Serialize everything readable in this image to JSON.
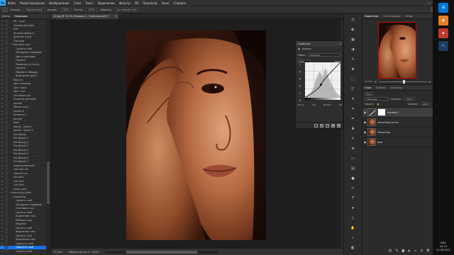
{
  "app": {
    "logo": "Ps",
    "menu": [
      "Файл",
      "Редактирование",
      "Изображение",
      "Слои",
      "Текст",
      "Выделение",
      "Фильтр",
      "3D",
      "Просмотр",
      "Окно",
      "Справка"
    ],
    "window_controls": [
      "—",
      "❐",
      "✕"
    ]
  },
  "options": {
    "fields": [
      {
        "label": "Размер:",
        "value": "Нормальный"
      },
      {
        "label": "Нажим:",
        "value": "100%"
      },
      {
        "label": "Поток:",
        "value": "100%"
      },
      {
        "label": "Образец:",
        "value": "Активный слой"
      }
    ],
    "icons": [
      "search-icon",
      "workspace-icon",
      "share-icon"
    ]
  },
  "left_panel": {
    "tabs": [
      "Кисти",
      "Операции"
    ],
    "active_tab": "Операции",
    "actions": [
      {
        "label": "RB - Layer",
        "indent": 1,
        "caret": false
      },
      {
        "label": "Гринфи для fixed",
        "indent": 1,
        "caret": false
      },
      {
        "label": "Dub",
        "indent": 1,
        "caret": false
      },
      {
        "label": "Интерактивность",
        "indent": 1,
        "caret": false
      },
      {
        "label": "Дожатие и осв",
        "indent": 1,
        "caret": false
      },
      {
        "label": "Текстура",
        "indent": 1,
        "caret": false
      },
      {
        "label": "Контроль пор",
        "indent": 1,
        "caret": true
      },
      {
        "label": "Сделать слой",
        "indent": 2,
        "caret": false
      },
      {
        "label": "Объединить видимые",
        "indent": 2,
        "caret": false
      },
      {
        "label": "Цвет в цветовые",
        "indent": 2,
        "caret": false
      },
      {
        "label": "Сделать",
        "indent": 2,
        "caret": false
      },
      {
        "label": "Размытие по Гауссу",
        "indent": 2,
        "caret": false
      },
      {
        "label": "Сделать",
        "indent": 2,
        "caret": false
      },
      {
        "label": "Обратить Обводку",
        "indent": 2,
        "caret": false
      },
      {
        "label": "Выделение цвета",
        "indent": 2,
        "caret": false
      },
      {
        "label": "Яркость",
        "indent": 1,
        "caret": false
      },
      {
        "label": "Цвет площади",
        "indent": 1,
        "caret": false
      },
      {
        "label": "Цвет кожи",
        "indent": 1,
        "caret": false
      },
      {
        "label": "Цвет глаз",
        "indent": 1,
        "caret": false
      },
      {
        "label": "Gilla Boxes сол",
        "indent": 1,
        "caret": false
      },
      {
        "label": "Усиление деталей",
        "indent": 1,
        "caret": false
      },
      {
        "label": "резкий",
        "indent": 1,
        "caret": false
      },
      {
        "label": "Общая кожа",
        "indent": 1,
        "caret": false
      },
      {
        "label": "резкость",
        "indent": 1,
        "caret": false
      },
      {
        "label": "резкость 2",
        "indent": 1,
        "caret": false
      },
      {
        "label": "резкий",
        "indent": 1,
        "caret": false
      },
      {
        "label": "Цвет",
        "indent": 1,
        "caret": false
      },
      {
        "label": "beauty - Бьюти",
        "indent": 1,
        "caret": false
      },
      {
        "label": "beauty - Бьюти 2",
        "indent": 1,
        "caret": false
      },
      {
        "label": "fine Beauty",
        "indent": 1,
        "caret": false
      },
      {
        "label": "fine Beauty 1",
        "indent": 1,
        "caret": false
      },
      {
        "label": "fine Beauty 2",
        "indent": 1,
        "caret": false
      },
      {
        "label": "fine Beauty 3",
        "indent": 1,
        "caret": false
      },
      {
        "label": "fine Beauty 4",
        "indent": 1,
        "caret": false
      },
      {
        "label": "fine Beauty 5",
        "indent": 1,
        "caret": false
      },
      {
        "label": "fine Beauty 6",
        "indent": 1,
        "caret": false
      },
      {
        "label": "fine Beauty 7",
        "indent": 1,
        "caret": false
      },
      {
        "label": "художественный",
        "indent": 1,
        "caret": false
      },
      {
        "label": "светлый тон",
        "indent": 1,
        "caret": false
      },
      {
        "label": "тёмный тон",
        "indent": 1,
        "caret": false
      },
      {
        "label": "lab mest",
        "indent": 1,
        "caret": false
      },
      {
        "label": "Lab Chell",
        "indent": 1,
        "caret": false
      },
      {
        "label": "Lab Chell",
        "indent": 1,
        "caret": false
      },
      {
        "label": "новое дает",
        "indent": 1,
        "caret": false
      },
      {
        "label": "retouching_prime",
        "indent": 0,
        "caret": true
      },
      {
        "label": "retouching",
        "indent": 1,
        "caret": true
      },
      {
        "label": "Сделать слой",
        "indent": 2,
        "caret": false
      },
      {
        "label": "Объединить видимые",
        "indent": 2,
        "caret": false
      },
      {
        "label": "Установить как",
        "indent": 2,
        "caret": false
      },
      {
        "label": "Сделать слой",
        "indent": 2,
        "caret": false
      },
      {
        "label": "Выделение слоя",
        "indent": 2,
        "caret": false
      },
      {
        "label": "Обводка слоя",
        "indent": 2,
        "caret": false
      },
      {
        "label": "Медиана",
        "indent": 2,
        "caret": false
      },
      {
        "label": "Сделать слой",
        "indent": 2,
        "caret": false
      },
      {
        "label": "Выделение слоя",
        "indent": 2,
        "caret": false
      },
      {
        "label": "Сделать слой",
        "indent": 2,
        "caret": false
      },
      {
        "label": "Выделение слоя",
        "indent": 2,
        "caret": false
      },
      {
        "label": "Сдвинуть слой",
        "indent": 2,
        "caret": false
      },
      {
        "label": "Сдвинуть слой",
        "indent": 2,
        "caret": false
      },
      {
        "label": "Сделать слой",
        "indent": 2,
        "caret": false
      }
    ],
    "selected_index": 58
  },
  "document": {
    "tab_title": "20.jpg @ 33,3% (Кривые 1, Слой-маска/8) *",
    "tab_close": "✕",
    "zoom": "33,33%",
    "status": "Эффективность: 100%*"
  },
  "properties": {
    "title": "Свойства",
    "close": "✕",
    "type_label": "Кривые",
    "preset_label": "Набор:",
    "preset_value": "Заказная",
    "channel_value": "RGB",
    "auto_label": "Авто",
    "input_label": "Вход:",
    "input_value": "114",
    "output_label": "Выход:",
    "output_value": "94",
    "curve_points": [
      [
        0,
        0
      ],
      [
        114,
        94
      ],
      [
        255,
        255
      ]
    ],
    "histogram": [
      2,
      3,
      4,
      5,
      7,
      9,
      12,
      16,
      22,
      30,
      36,
      40,
      45,
      48,
      44,
      38,
      42,
      50,
      55,
      48,
      40,
      35,
      30,
      26,
      22,
      18,
      14,
      10,
      8,
      6,
      4,
      3
    ]
  },
  "navigator": {
    "tabs": [
      "Навигатор",
      "Гистограмма",
      "Инфо"
    ],
    "active_tab": "Навигатор",
    "zoom": "33,33%"
  },
  "layers": {
    "tabs": [
      "Слои",
      "Каналы",
      "Контуры"
    ],
    "active_tab": "Слои",
    "kind_label": "Вид",
    "blend_mode": "Обычные",
    "opacity_label": "Непрозр.:",
    "opacity": "100%",
    "lock_label": "Закреп.:",
    "fill_label": "Заливка:",
    "fill": "100%",
    "items": [
      {
        "name": "Кривые 1",
        "selected": true,
        "type": "adjustment"
      },
      {
        "name": "retouching corner",
        "selected": false,
        "type": "photo"
      },
      {
        "name": "retouching",
        "selected": false,
        "type": "photo"
      },
      {
        "name": "Фон",
        "selected": false,
        "type": "photo"
      }
    ]
  },
  "taskbar": {
    "lang": "ENG",
    "time": "22:10",
    "date": "21.06.2021"
  }
}
